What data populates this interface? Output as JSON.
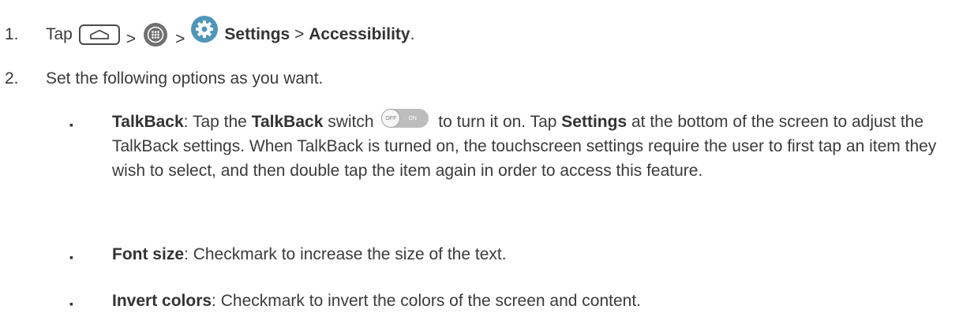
{
  "steps": [
    {
      "number": "1.",
      "tap": "Tap",
      "sep": ">",
      "settings": "Settings",
      "accessibility": "Accessibility",
      "period": "."
    },
    {
      "number": "2.",
      "text": "Set the following options as you want."
    }
  ],
  "bullets": [
    {
      "marker": "▪",
      "title": "TalkBack",
      "colon": ":",
      "pre": " Tap the ",
      "switch_name": "TalkBack",
      "mid": " switch",
      "post": " to turn it on. Tap ",
      "settings": "Settings",
      "rest": " at the bottom of the screen to adjust the TalkBack settings. When TalkBack is turned on, the touchscreen settings require the user to first tap an item they wish to select, and then double tap the item again in order to access this feature."
    },
    {
      "marker": "▪",
      "title": "Font size",
      "colon": ":",
      "text": " Checkmark to increase the size of the text."
    },
    {
      "marker": "▪",
      "title": "Invert colors",
      "colon": ":",
      "text": " Checkmark to invert the colors of the screen and content."
    }
  ],
  "toggle": {
    "off": "OFF",
    "on": "ON"
  },
  "icons": [
    "home-icon",
    "apps-icon",
    "settings-gear-icon",
    "toggle-switch-icon"
  ]
}
